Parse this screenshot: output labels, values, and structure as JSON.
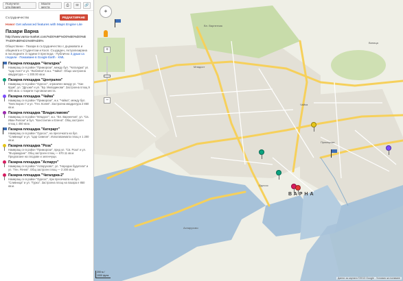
{
  "toolbar": {
    "print_label": "Получете упътвания",
    "my_places_label": "Моите места",
    "print_icon": "printer-icon",
    "mail_icon": "mail-icon",
    "link_icon": "link-icon"
  },
  "map_info": {
    "collaborators_label": "Сътрудничество",
    "edit_label": "РЕДАКТИРАНЕ",
    "new_badge": "Ново!",
    "new_text": "Get advanced features with Maps Engine Lite",
    "title": "Пазари Варна",
    "url": "http://www.varna-market.com/%D0%9F%D0%B0%D0%B7%D0%B0%D1%80%D0%",
    "description": "Обществени - Пазари в сътрудничество с държавата и общината и Студентски и Кооп. Създаден, Актуализирана в последните 3 години",
    "stats": "0 прегледа · Публично",
    "link_1": "3 души са гледали",
    "link_2": "Показване в Google Earth",
    "link_3": "KML"
  },
  "places": [
    {
      "title": "Пазарна площадка \"Чаталджа\"",
      "desc": "Намиращ се в район \"Приморски\", между бул. \"Чаталджа\" ул. \"Цар Асен\" и ул. \"Любляна\" в ж.к. \"Чайка\". Общо застроена квадратура — 1 300.00 кв.м.",
      "color": "#3d6eb6",
      "kind": "flag"
    },
    {
      "title": "Пазарна площадка \"Централен\"",
      "desc": "Намиращ се в район \"Одесос\", ограничен между ул. \"Хан Крум\", ул. \"Дръзки\" и ул. \"Бр. Миладинови\". Застроена площ 9 600 кв.м. с покрити търговски места.",
      "color": "#0aa37f",
      "kind": "pin"
    },
    {
      "title": "Пазарна площадка \"Чайка\"",
      "desc": "Намиращ се в район \"Приморски\", ж.к. \"Чайка\", между бул. \"Княз Борис I\" и ул. \"Ген. Колев\". Застроена квадратура 2 850 кв.м.",
      "color": "#7c4dff",
      "kind": "pin"
    },
    {
      "title": "Пазарна площадка \"Владиславово\"",
      "desc": "Намиращ се в район \"Младост\", ж.к. \"Вл. Варненчик\", ул. \"Св. Иван Рилски\" и бул. \"Константин и Елена\". Общ застроен площ 1 450 кв.м.",
      "color": "#9c27b0",
      "kind": "pin"
    },
    {
      "title": "Пазарна площадка \"Катерарт\"",
      "desc": "Намиращ се в район \"Одесос\", на пресечката на бул. \"Сливница\" и ул. \"Цар Симеон\". Използваемата площ е 1 200 кв.м.",
      "color": "#3d6eb6",
      "kind": "flag"
    },
    {
      "title": "Пазарна площадка \"Роза\"",
      "desc": "Намиращ се в район \"Приморски\", пред ул. \"Св. Роза\" и ул. \"Възраждане\". Общ застроен площ — 670.11 кв.м. Предлагане на плодове и зеленчуци.",
      "color": "#e6c619",
      "kind": "pin"
    },
    {
      "title": "Пазарна площадка \"Аспарух\"",
      "desc": "Намиращ се в район \"Аспарухово\", ул. \"Народни будители\" и ул. \"Ген. Рачев\". Общ застроен площ — 3 200 кв.м.",
      "color": "#d81b60",
      "kind": "pin"
    },
    {
      "title": "Пазарна площадка \"Чаталджа-2\"",
      "desc": "Намиращ се в район \"Одесос\", при пресечката на бул. \"Сливница\" и ул. \"Гурко\". Застроена площ на пазара е 850 кв.м.",
      "color": "#d81b60",
      "kind": "pin"
    }
  ],
  "map": {
    "city_label": "ВАРНА",
    "scale_label": "200 м / 1000 фута",
    "attribution": "Данни за картата ©2013 Google - Условия за ползване",
    "area_labels": [
      "Младост",
      "Вл. Варненчик",
      "Чайка",
      "Одесос",
      "Приморски",
      "Аспарухово",
      "Виница"
    ],
    "icons": {
      "pan": "pan-control-icon",
      "pegman": "pegman-icon",
      "zoom_in": "zoom-in-icon",
      "zoom_out": "zoom-out-icon"
    },
    "zoom_in_label": "+",
    "zoom_out_label": "−",
    "colors": {
      "water": "#a7c2d9",
      "land": "#efefe6",
      "urban": "#e3e0d6",
      "park": "#c8dcaa",
      "highway": "#f6d05b"
    }
  }
}
